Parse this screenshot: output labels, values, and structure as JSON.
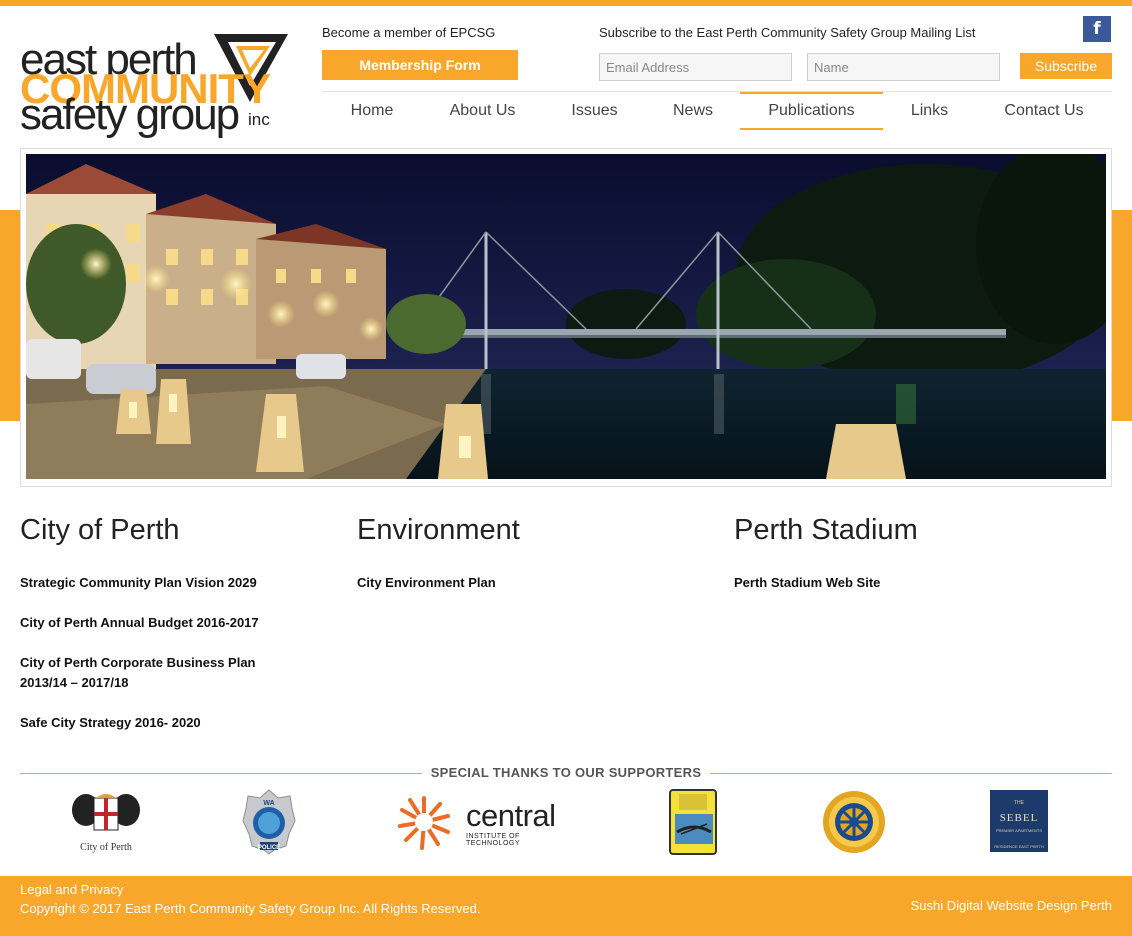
{
  "logo": {
    "line1": "east perth",
    "line2": "COMMUNITY",
    "line3": "safety group",
    "suffix": "inc"
  },
  "header": {
    "member_text": "Become a member of EPCSG",
    "member_button": "Membership Form",
    "subscribe_text": "Subscribe to the East Perth Community Safety Group Mailing List",
    "email_placeholder": "Email Address",
    "name_placeholder": "Name",
    "subscribe_button": "Subscribe",
    "facebook_icon": "f"
  },
  "nav": {
    "items": [
      {
        "label": "Home"
      },
      {
        "label": "About Us"
      },
      {
        "label": "Issues"
      },
      {
        "label": "News"
      },
      {
        "label": "Publications"
      },
      {
        "label": "Links"
      },
      {
        "label": "Contact Us"
      }
    ],
    "active": "Publications"
  },
  "columns": [
    {
      "title": "City of Perth",
      "links": [
        "Strategic Community Plan Vision 2029",
        "City of Perth Annual Budget 2016-2017",
        "City of Perth Corporate Business Plan 2013/14 – 2017/18",
        "Safe City Strategy 2016- 2020"
      ]
    },
    {
      "title": "Environment",
      "links": [
        "City Environment Plan"
      ]
    },
    {
      "title": "Perth Stadium",
      "links": [
        "Perth Stadium Web Site"
      ]
    }
  ],
  "supporters": {
    "title": "SPECIAL THANKS TO OUR SUPPORTERS",
    "logos": [
      {
        "name": "city-of-perth-logo",
        "text": "City of Perth"
      },
      {
        "name": "wa-police-logo",
        "text_top": "WA",
        "text_bottom": "POLICE"
      },
      {
        "name": "central-logo",
        "text": "central",
        "subtext": "INSTITUTE OF TECHNOLOGY"
      },
      {
        "name": "rowing-club-logo"
      },
      {
        "name": "rotary-logo",
        "text": "ROTARY INTERNATIONAL"
      },
      {
        "name": "sebel-logo",
        "text_top": "THE",
        "text": "SEBEL",
        "subtext": "PREMIER APARTMENTS",
        "subtext2": "RESIDENCE EAST PERTH"
      }
    ]
  },
  "footer": {
    "legal": "Legal and Privacy",
    "copyright": "Copyright © 2017 East Perth Community Safety Group Inc. All Rights Reserved.",
    "credit": "Sushi Digital Website Design Perth"
  },
  "colors": {
    "accent": "#f9a72b",
    "facebook": "#3b5998"
  }
}
